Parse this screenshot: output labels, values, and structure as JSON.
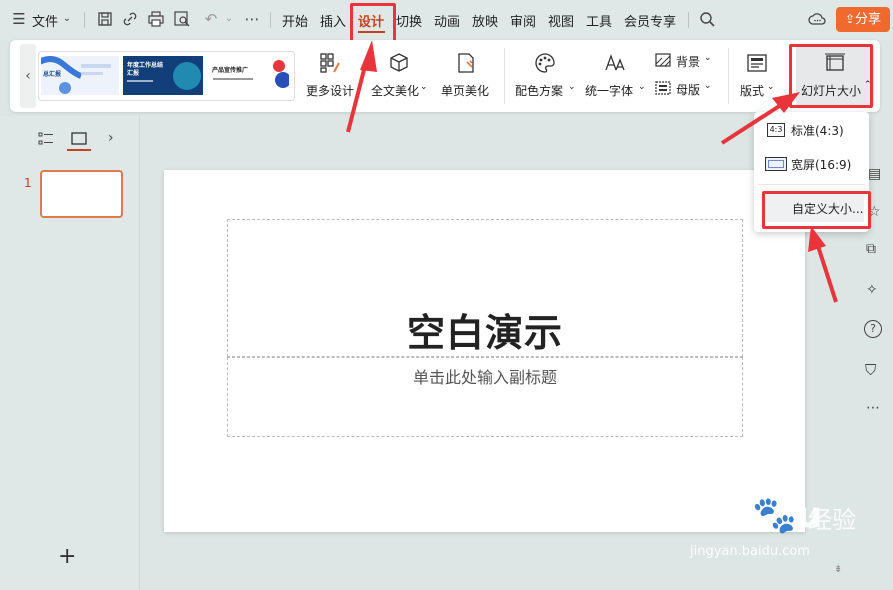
{
  "menubar": {
    "file_label": "文件",
    "tabs": [
      "开始",
      "插入",
      "设计",
      "切换",
      "动画",
      "放映",
      "审阅",
      "视图",
      "工具",
      "会员专享"
    ],
    "active_tab": "设计",
    "share_label": "分享"
  },
  "ribbon": {
    "templates": [
      {
        "title": "总汇报",
        "bg": "#ffffff"
      },
      {
        "title": "年度工作总结汇报",
        "bg": "#1a4b8c"
      },
      {
        "title": "产品宣传推广",
        "bg": "#ffffff"
      }
    ],
    "more_design": "更多设计",
    "beautify_all": "全文美化",
    "beautify_page": "单页美化",
    "color_scheme": "配色方案",
    "unify_font": "统一字体",
    "background": "背景",
    "master": "母版",
    "layout": "版式",
    "slide_size": "幻灯片大小"
  },
  "dropdown": {
    "standard": "标准(4:3)",
    "standard_icon_text": "4:3",
    "widescreen": "宽屏(16:9)",
    "custom": "自定义大小..."
  },
  "left_panel": {
    "slide_number": "1",
    "add_symbol": "+"
  },
  "slide": {
    "title": "空白演示",
    "subtitle": "单击此处输入副标题"
  },
  "watermark": {
    "text_cn": "经验",
    "url": "jingyan.baidu.com"
  },
  "colors": {
    "accent": "#c8401e",
    "share": "#f06a2f",
    "highlight_red": "#e8353b",
    "slide_border_selected": "#e07a4a"
  }
}
